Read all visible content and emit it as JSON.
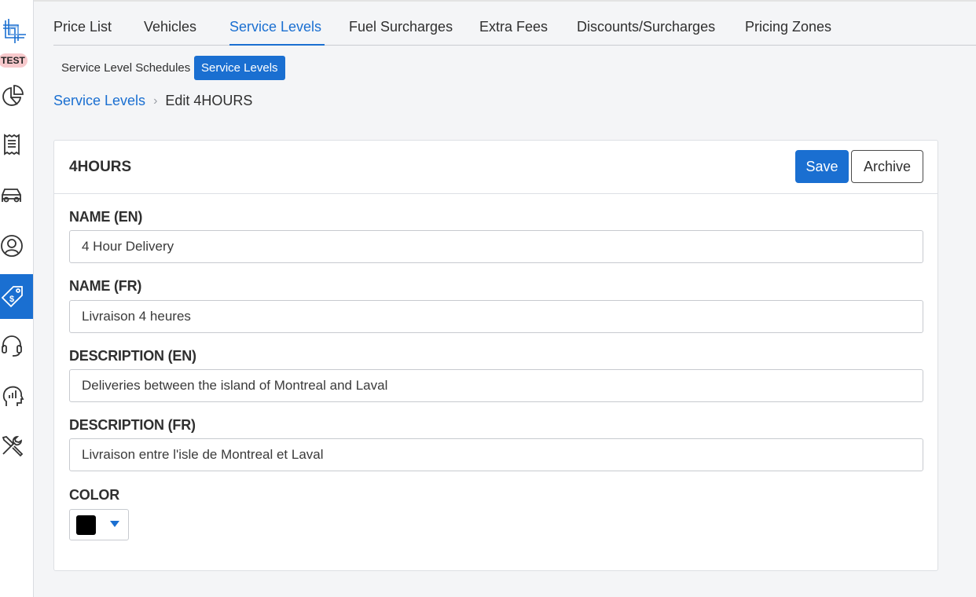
{
  "sidebar": {
    "badge": "TEST",
    "icons": [
      "logo-icon",
      "chart-pie-icon",
      "receipt-icon",
      "car-icon",
      "user-icon",
      "price-tag-icon",
      "headset-icon",
      "analytics-head-icon",
      "tools-icon"
    ],
    "active_icon": "price-tag-icon"
  },
  "tabs": [
    {
      "label": "Price List",
      "active": false
    },
    {
      "label": "Vehicles",
      "active": false
    },
    {
      "label": "Service Levels",
      "active": true
    },
    {
      "label": "Fuel Surcharges",
      "active": false
    },
    {
      "label": "Extra Fees",
      "active": false
    },
    {
      "label": "Discounts/Surcharges",
      "active": false
    },
    {
      "label": "Pricing Zones",
      "active": false
    }
  ],
  "subtabs": [
    {
      "label": "Service Level Schedules",
      "active": false
    },
    {
      "label": "Service Levels",
      "active": true
    }
  ],
  "breadcrumb": {
    "parent": "Service Levels",
    "current": "Edit 4HOURS"
  },
  "card": {
    "title": "4HOURS",
    "save_label": "Save",
    "archive_label": "Archive"
  },
  "form": {
    "name_en": {
      "label": "NAME (EN)",
      "value": "4 Hour Delivery"
    },
    "name_fr": {
      "label": "NAME (FR)",
      "value": "Livraison 4 heures"
    },
    "description_en": {
      "label": "DESCRIPTION (EN)",
      "value": "Deliveries between the island of Montreal and Laval"
    },
    "description_fr": {
      "label": "DESCRIPTION (FR)",
      "value": "Livraison entre l'isle de Montreal et Laval"
    },
    "color": {
      "label": "COLOR",
      "value": "#000000"
    }
  },
  "colors": {
    "accent": "#1a6fd1",
    "badge_bg": "#f7c9cc"
  }
}
